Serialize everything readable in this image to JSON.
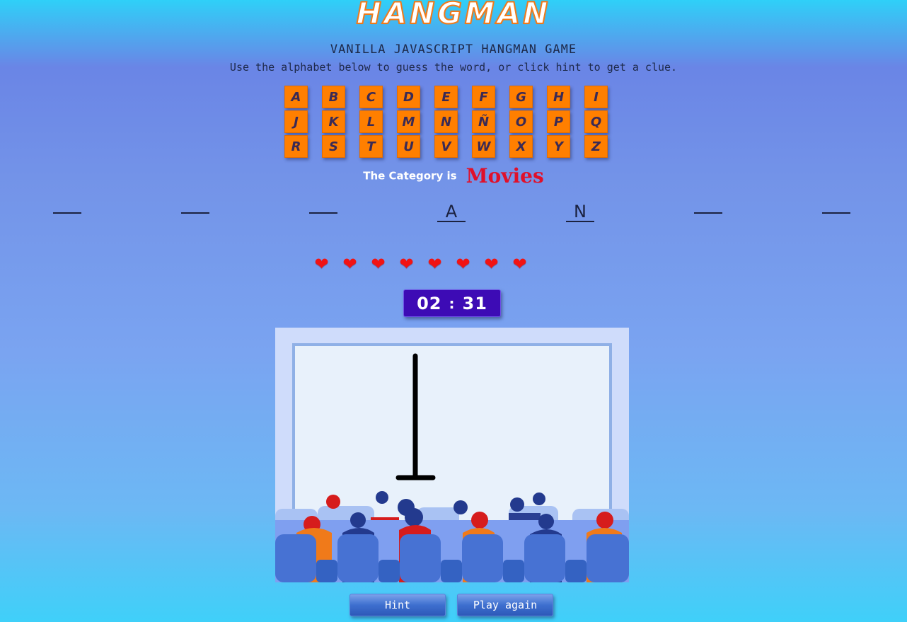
{
  "header": {
    "logo": "HANGMAN",
    "subtitle": "VANILLA JAVASCRIPT HANGMAN GAME",
    "instructions": "Use the alphabet below to guess the word, or click hint to get a clue."
  },
  "alphabet": [
    "A",
    "B",
    "C",
    "D",
    "E",
    "F",
    "G",
    "H",
    "I",
    "J",
    "K",
    "L",
    "M",
    "N",
    "Ñ",
    "O",
    "P",
    "Q",
    "R",
    "S",
    "T",
    "U",
    "V",
    "W",
    "X",
    "Y",
    "Z"
  ],
  "category": {
    "label": "The Category is",
    "value": "Movies"
  },
  "word": [
    "",
    "",
    "",
    "A",
    "N",
    "",
    ""
  ],
  "lives": {
    "remaining": 8,
    "icon": "heart-icon"
  },
  "timer": {
    "minutes": "02",
    "separator": ":",
    "seconds": "31"
  },
  "buttons": {
    "hint": "Hint",
    "play_again": "Play again"
  },
  "colors": {
    "key_bg": "#ff7f00",
    "category": "#e0102a",
    "timer_bg": "#3d0bb5"
  }
}
